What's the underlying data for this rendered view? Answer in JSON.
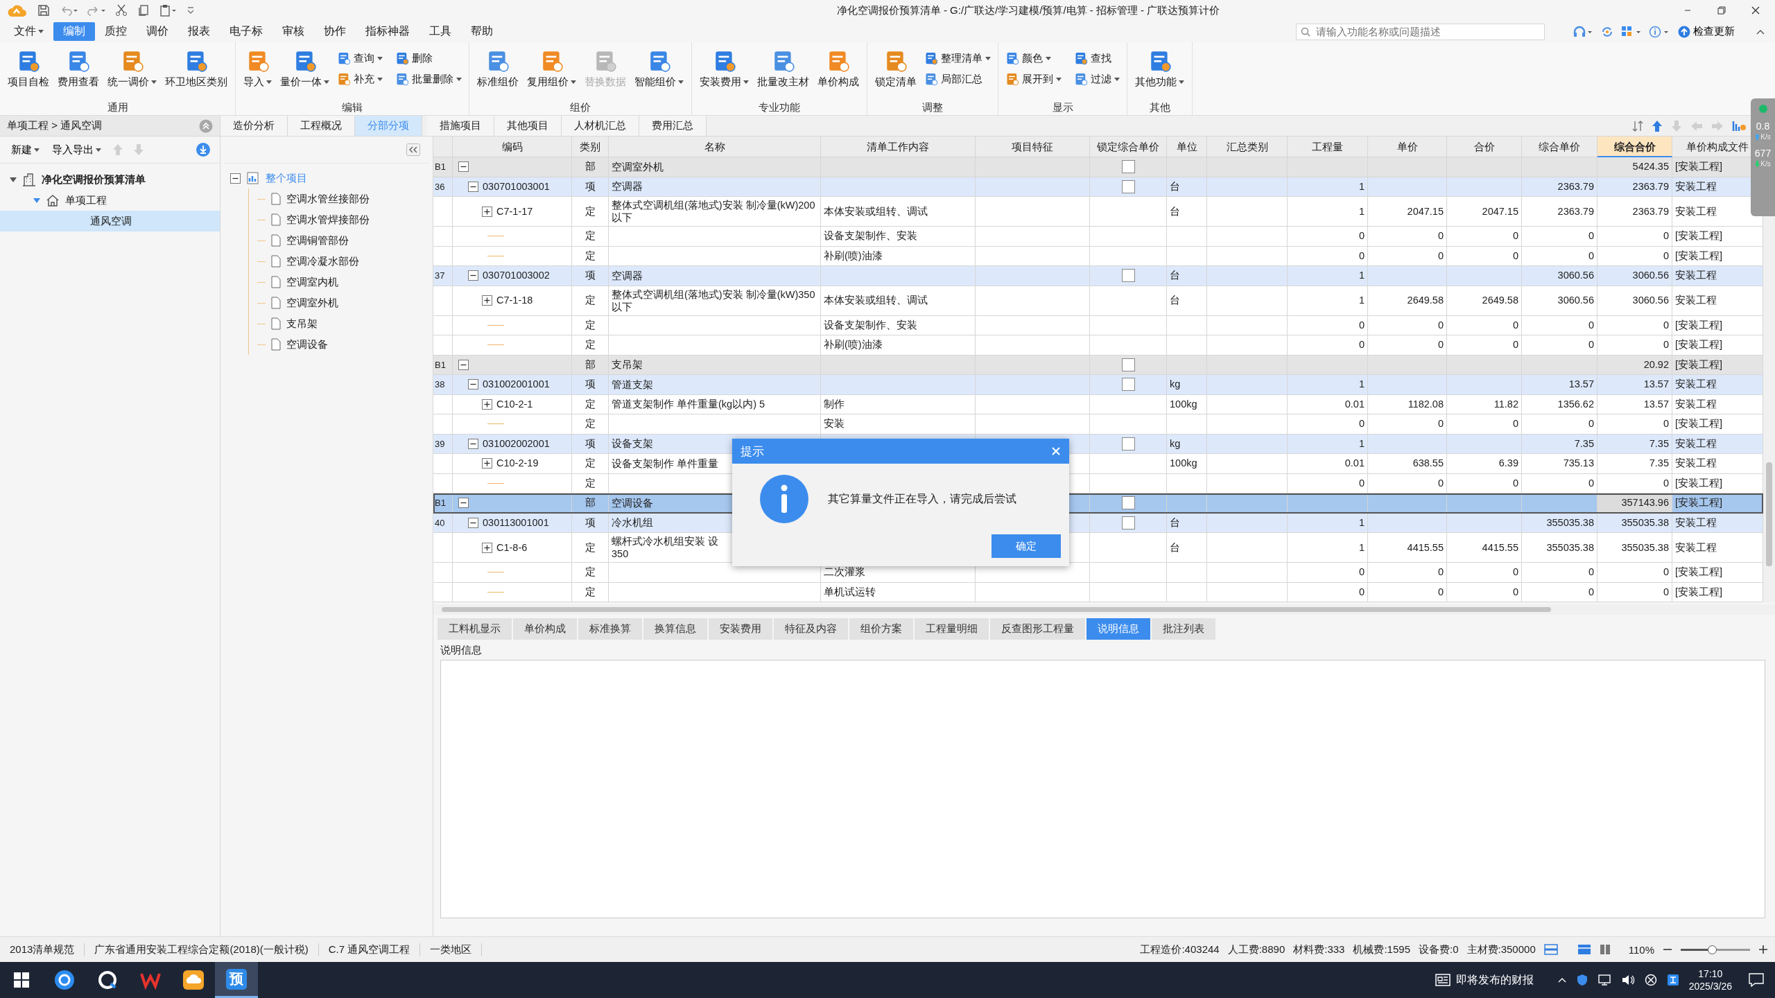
{
  "title": "净化空调报价预算清单 - G:/广联达/学习建模/预算/电算 - 招标管理 - 广联达预算计价",
  "menu": [
    {
      "label": "文件",
      "dropdown": true,
      "selected": false
    },
    {
      "label": "编制",
      "dropdown": false,
      "selected": true
    },
    {
      "label": "质控",
      "dropdown": false,
      "selected": false
    },
    {
      "label": "调价",
      "dropdown": false,
      "selected": false
    },
    {
      "label": "报表",
      "dropdown": false,
      "selected": false
    },
    {
      "label": "电子标",
      "dropdown": false,
      "selected": false
    },
    {
      "label": "审核",
      "dropdown": false,
      "selected": false
    },
    {
      "label": "协作",
      "dropdown": false,
      "selected": false
    },
    {
      "label": "指标神器",
      "dropdown": false,
      "selected": false
    },
    {
      "label": "工具",
      "dropdown": false,
      "selected": false
    },
    {
      "label": "帮助",
      "dropdown": false,
      "selected": false
    }
  ],
  "search": {
    "placeholder": "请输入功能名称或问题描述"
  },
  "update_label": "检查更新",
  "ribbon": [
    {
      "title": "通用",
      "buttons": [
        {
          "label": "项目自检",
          "kind": "large",
          "dropdown": false,
          "disabled": false
        },
        {
          "label": "费用查看",
          "kind": "large",
          "dropdown": false,
          "disabled": false
        },
        {
          "label": "统一调价",
          "kind": "large",
          "dropdown": true,
          "disabled": false
        },
        {
          "label": "环卫地区类别",
          "kind": "large",
          "dropdown": false,
          "disabled": false
        }
      ]
    },
    {
      "title": "编辑",
      "buttons": [
        {
          "label": "导入",
          "kind": "large",
          "dropdown": true,
          "disabled": false
        },
        {
          "label": "量价一体",
          "kind": "large",
          "dropdown": true,
          "disabled": false
        },
        {
          "label": "查询",
          "kind": "small",
          "dropdown": true,
          "disabled": false
        },
        {
          "label": "补充",
          "kind": "small",
          "dropdown": true,
          "disabled": false
        },
        {
          "label": "删除",
          "kind": "small",
          "dropdown": false,
          "disabled": false
        },
        {
          "label": "批量删除",
          "kind": "small",
          "dropdown": true,
          "disabled": false
        }
      ]
    },
    {
      "title": "组价",
      "buttons": [
        {
          "label": "标准组价",
          "kind": "large",
          "dropdown": false,
          "disabled": false
        },
        {
          "label": "复用组价",
          "kind": "large",
          "dropdown": true,
          "disabled": false
        },
        {
          "label": "替换数据",
          "kind": "large",
          "dropdown": false,
          "disabled": true
        },
        {
          "label": "智能组价",
          "kind": "large",
          "dropdown": true,
          "disabled": false
        }
      ]
    },
    {
      "title": "专业功能",
      "buttons": [
        {
          "label": "安装费用",
          "kind": "large",
          "dropdown": true,
          "disabled": false
        },
        {
          "label": "批量改主材",
          "kind": "large",
          "dropdown": false,
          "disabled": false
        },
        {
          "label": "单价构成",
          "kind": "large",
          "dropdown": false,
          "disabled": false
        }
      ]
    },
    {
      "title": "调整",
      "buttons": [
        {
          "label": "锁定清单",
          "kind": "large",
          "dropdown": false,
          "disabled": false
        },
        {
          "label": "整理清单",
          "kind": "small",
          "dropdown": true,
          "disabled": false
        },
        {
          "label": "局部汇总",
          "kind": "small",
          "dropdown": false,
          "disabled": false
        }
      ]
    },
    {
      "title": "显示",
      "buttons": [
        {
          "label": "颜色",
          "kind": "small",
          "dropdown": true,
          "disabled": false
        },
        {
          "label": "展开到",
          "kind": "small",
          "dropdown": true,
          "disabled": false
        },
        {
          "label": "查找",
          "kind": "small",
          "dropdown": false,
          "disabled": false
        },
        {
          "label": "过滤",
          "kind": "small",
          "dropdown": true,
          "disabled": false
        }
      ]
    },
    {
      "title": "其他",
      "buttons": [
        {
          "label": "其他功能",
          "kind": "large",
          "dropdown": true,
          "disabled": false
        }
      ]
    }
  ],
  "breadcrumb": "单项工程 > 通风空调",
  "left_toolbar": [
    {
      "label": "新建",
      "dropdown": true
    },
    {
      "label": "导入导出",
      "dropdown": true
    }
  ],
  "project_tree": [
    {
      "label": "净化空调报价预算清单",
      "expanded": true,
      "selected": false,
      "children": [
        {
          "label": "单项工程",
          "expanded": true,
          "selected": false,
          "children": [
            {
              "label": "通风空调",
              "selected": true
            }
          ]
        }
      ]
    }
  ],
  "main_tabs": [
    {
      "label": "造价分析",
      "selected": false
    },
    {
      "label": "工程概况",
      "selected": false
    },
    {
      "label": "分部分项",
      "selected": true
    },
    {
      "label": "措施项目",
      "selected": false
    },
    {
      "label": "其他项目",
      "selected": false
    },
    {
      "label": "人材机汇总",
      "selected": false
    },
    {
      "label": "费用汇总",
      "selected": false
    }
  ],
  "section_tree": {
    "label": "整个项目",
    "expanded": true,
    "selected": true,
    "children": [
      {
        "label": "空调水管丝接部份"
      },
      {
        "label": "空调水管焊接部份"
      },
      {
        "label": "空调铜管部份"
      },
      {
        "label": "空调冷凝水部份"
      },
      {
        "label": "空调室内机"
      },
      {
        "label": "空调室外机"
      },
      {
        "label": "支吊架"
      },
      {
        "label": "空调设备"
      }
    ]
  },
  "table": {
    "columns": [
      {
        "label": "编码",
        "selected": false
      },
      {
        "label": "类别",
        "selected": false
      },
      {
        "label": "名称",
        "selected": false
      },
      {
        "label": "清单工作内容",
        "selected": false
      },
      {
        "label": "项目特征",
        "selected": false
      },
      {
        "label": "锁定综合单价",
        "selected": false
      },
      {
        "label": "单位",
        "selected": false
      },
      {
        "label": "汇总类别",
        "selected": false
      },
      {
        "label": "工程量",
        "selected": false
      },
      {
        "label": "单价",
        "selected": false
      },
      {
        "label": "合价",
        "selected": false
      },
      {
        "label": "综合单价",
        "selected": false
      },
      {
        "label": "综合合价",
        "selected": true
      },
      {
        "label": "单价构成文件",
        "selected": false
      }
    ],
    "rows": [
      {
        "kind": "section",
        "no": "B1",
        "type": "部",
        "name": "空调室外机",
        "expanded": true,
        "checked": false,
        "comp_total": "5424.35",
        "file": "[安装工程]",
        "selected": false
      },
      {
        "kind": "item",
        "no": "36",
        "code": "030701003001",
        "expanded": true,
        "type": "项",
        "name": "空调器",
        "checked": false,
        "unit": "台",
        "qty": "1",
        "comp_price": "2363.79",
        "comp_total": "2363.79",
        "file": "安装工程",
        "selected": false
      },
      {
        "kind": "quota",
        "code": "C7-1-17",
        "expanded": false,
        "type": "定",
        "name": "整体式空调机组(落地式)安装 制冷量(kW)200以下",
        "content": "本体安装或组转、调试",
        "unit": "台",
        "qty": "1",
        "price": "2047.15",
        "total": "2047.15",
        "comp_price": "2363.79",
        "comp_total": "2363.79",
        "file": "安装工程",
        "selected": false
      },
      {
        "kind": "sub",
        "type": "定",
        "content": "设备支架制作、安装",
        "qty": "0",
        "price": "0",
        "total": "0",
        "comp_price": "0",
        "comp_total": "0",
        "file": "[安装工程]",
        "selected": false
      },
      {
        "kind": "sub",
        "type": "定",
        "content": "补刷(喷)油漆",
        "qty": "0",
        "price": "0",
        "total": "0",
        "comp_price": "0",
        "comp_total": "0",
        "file": "[安装工程]",
        "selected": false
      },
      {
        "kind": "item",
        "no": "37",
        "code": "030701003002",
        "expanded": true,
        "type": "项",
        "name": "空调器",
        "checked": false,
        "unit": "台",
        "qty": "1",
        "comp_price": "3060.56",
        "comp_total": "3060.56",
        "file": "安装工程",
        "selected": false
      },
      {
        "kind": "quota",
        "code": "C7-1-18",
        "expanded": false,
        "type": "定",
        "name": "整体式空调机组(落地式)安装 制冷量(kW)350以下",
        "content": "本体安装或组转、调试",
        "unit": "台",
        "qty": "1",
        "price": "2649.58",
        "total": "2649.58",
        "comp_price": "3060.56",
        "comp_total": "3060.56",
        "file": "安装工程",
        "selected": false
      },
      {
        "kind": "sub",
        "type": "定",
        "content": "设备支架制作、安装",
        "qty": "0",
        "price": "0",
        "total": "0",
        "comp_price": "0",
        "comp_total": "0",
        "file": "[安装工程]",
        "selected": false
      },
      {
        "kind": "sub",
        "type": "定",
        "content": "补刷(喷)油漆",
        "qty": "0",
        "price": "0",
        "total": "0",
        "comp_price": "0",
        "comp_total": "0",
        "file": "[安装工程]",
        "selected": false
      },
      {
        "kind": "section",
        "no": "B1",
        "type": "部",
        "name": "支吊架",
        "expanded": true,
        "checked": false,
        "comp_total": "20.92",
        "file": "[安装工程]",
        "selected": false
      },
      {
        "kind": "item",
        "no": "38",
        "code": "031002001001",
        "expanded": true,
        "type": "项",
        "name": "管道支架",
        "checked": false,
        "unit": "kg",
        "qty": "1",
        "comp_price": "13.57",
        "comp_total": "13.57",
        "file": "安装工程",
        "selected": false
      },
      {
        "kind": "quota",
        "code": "C10-2-1",
        "expanded": false,
        "type": "定",
        "name": "管道支架制作 单件重量(kg以内) 5",
        "content": "制作",
        "unit": "100kg",
        "qty": "0.01",
        "price": "1182.08",
        "total": "11.82",
        "comp_price": "1356.62",
        "comp_total": "13.57",
        "file": "安装工程",
        "selected": false
      },
      {
        "kind": "sub",
        "type": "定",
        "content": "安装",
        "qty": "0",
        "price": "0",
        "total": "0",
        "comp_price": "0",
        "comp_total": "0",
        "file": "[安装工程]",
        "selected": false
      },
      {
        "kind": "item",
        "no": "39",
        "code": "031002002001",
        "expanded": true,
        "type": "项",
        "name": "设备支架",
        "checked": false,
        "unit": "kg",
        "qty": "1",
        "comp_price": "7.35",
        "comp_total": "7.35",
        "file": "安装工程",
        "selected": false
      },
      {
        "kind": "quota",
        "code": "C10-2-19",
        "expanded": false,
        "type": "定",
        "name": "设备支架制作 单件重量",
        "unit": "100kg",
        "qty": "0.01",
        "price": "638.55",
        "total": "6.39",
        "comp_price": "735.13",
        "comp_total": "7.35",
        "file": "安装工程",
        "selected": false
      },
      {
        "kind": "sub",
        "type": "定",
        "qty": "0",
        "price": "0",
        "total": "0",
        "comp_price": "0",
        "comp_total": "0",
        "file": "[安装工程]",
        "selected": false
      },
      {
        "kind": "section",
        "no": "B1",
        "type": "部",
        "name": "空调设备",
        "expanded": true,
        "checked": false,
        "comp_total": "357143.96",
        "file": "[安装工程]",
        "selected": true
      },
      {
        "kind": "item",
        "no": "40",
        "code": "030113001001",
        "expanded": true,
        "type": "项",
        "name": "冷水机组",
        "checked": false,
        "unit": "台",
        "qty": "1",
        "comp_price": "355035.38",
        "comp_total": "355035.38",
        "file": "安装工程",
        "selected": false
      },
      {
        "kind": "quota",
        "code": "C1-8-6",
        "expanded": false,
        "type": "定",
        "name": "螺杆式冷水机组安装 设\n350",
        "unit": "台",
        "qty": "1",
        "price": "4415.55",
        "total": "4415.55",
        "comp_price": "355035.38",
        "comp_total": "355035.38",
        "file": "安装工程",
        "selected": false
      },
      {
        "kind": "sub",
        "type": "定",
        "content": "二次灌浆",
        "qty": "0",
        "price": "0",
        "total": "0",
        "comp_price": "0",
        "comp_total": "0",
        "file": "[安装工程]",
        "selected": false
      },
      {
        "kind": "sub",
        "type": "定",
        "content": "单机试运转",
        "qty": "0",
        "price": "0",
        "total": "0",
        "comp_price": "0",
        "comp_total": "0",
        "file": "[安装工程]",
        "selected": false
      }
    ]
  },
  "bottom_tabs": [
    {
      "label": "工料机显示",
      "selected": false
    },
    {
      "label": "单价构成",
      "selected": false
    },
    {
      "label": "标准换算",
      "selected": false
    },
    {
      "label": "换算信息",
      "selected": false
    },
    {
      "label": "安装费用",
      "selected": false
    },
    {
      "label": "特征及内容",
      "selected": false
    },
    {
      "label": "组价方案",
      "selected": false
    },
    {
      "label": "工程量明细",
      "selected": false
    },
    {
      "label": "反查图形工程量",
      "selected": false
    },
    {
      "label": "说明信息",
      "selected": true
    },
    {
      "label": "批注列表",
      "selected": false
    }
  ],
  "description_label": "说明信息",
  "dialog": {
    "title": "提示",
    "message": "其它算量文件正在导入，请完成后尝试",
    "button": "确定"
  },
  "net_widget": {
    "upload": "0.8",
    "upload_unit": "K/s",
    "download": "677",
    "download_unit": "K/s"
  },
  "status_left": [
    "2013清单规范",
    "广东省通用安装工程综合定额(2018)(一般计税)",
    "C.7 通风空调工程",
    "一类地区"
  ],
  "status_right": [
    "工程造价:403244",
    "人工费:8890",
    "材料费:333",
    "机械费:1595",
    "设备费:0",
    "主材费:350000"
  ],
  "zoom": {
    "label": "110%",
    "level": 0.45
  },
  "taskbar": {
    "apps": [
      {
        "kind": "round",
        "selected": false
      },
      {
        "kind": "ring",
        "selected": false
      },
      {
        "kind": "wps",
        "selected": false
      },
      {
        "kind": "cloud",
        "selected": false
      },
      {
        "kind": "glyph",
        "text": "预",
        "selected": true
      }
    ],
    "news": "即将发布的财报",
    "time": "17:10",
    "date": "2025/3/26"
  }
}
